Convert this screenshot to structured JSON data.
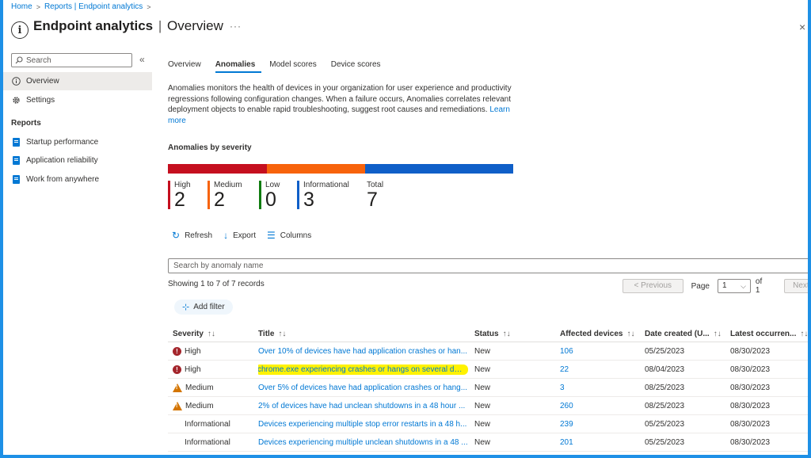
{
  "breadcrumb": {
    "home": "Home",
    "reports": "Reports | Endpoint analytics",
    "sep": ">"
  },
  "header": {
    "title_main": "Endpoint analytics",
    "title_sep": "|",
    "title_sub": "Overview",
    "more": "···",
    "close": "×"
  },
  "sidebar": {
    "search_placeholder": "Search",
    "collapse": "«",
    "items": [
      {
        "label": "Overview",
        "icon": "info-icon",
        "active": true
      },
      {
        "label": "Settings",
        "icon": "gear-icon",
        "active": false
      }
    ],
    "reports_heading": "Reports",
    "reports": [
      {
        "label": "Startup performance",
        "icon": "report-icon"
      },
      {
        "label": "Application reliability",
        "icon": "report-icon"
      },
      {
        "label": "Work from anywhere",
        "icon": "report-icon"
      }
    ]
  },
  "tabs": [
    {
      "label": "Overview",
      "active": false
    },
    {
      "label": "Anomalies",
      "active": true
    },
    {
      "label": "Model scores",
      "active": false
    },
    {
      "label": "Device scores",
      "active": false
    }
  ],
  "description": {
    "text": "Anomalies monitors the health of devices in your organization for user experience and productivity regressions following configuration changes. When a failure occurs, Anomalies correlates relevant deployment objects to enable rapid troubleshooting, suggest root causes and remediations.",
    "link": "Learn more"
  },
  "severity": {
    "heading": "Anomalies by severity",
    "colors": {
      "high": "#c50f1f",
      "medium": "#f7630c",
      "low": "#107c10",
      "informational": "#0f5fc8"
    },
    "stats": [
      {
        "label": "High",
        "value": 2
      },
      {
        "label": "Medium",
        "value": 2
      },
      {
        "label": "Low",
        "value": 0
      },
      {
        "label": "Informational",
        "value": 3
      },
      {
        "label": "Total",
        "value": 7
      }
    ]
  },
  "toolbar": {
    "refresh": "Refresh",
    "export": "Export",
    "columns": "Columns"
  },
  "search_anomaly_placeholder": "Search by anomaly name",
  "showing": "Showing 1 to 7 of 7 records",
  "pager": {
    "previous": "< Previous",
    "page_label": "Page",
    "page_value": "1",
    "of": "of 1",
    "next": "Next >"
  },
  "add_filter": "Add filter",
  "table": {
    "headers": [
      "Severity",
      "Title",
      "Status",
      "Affected devices",
      "Date created (U...",
      "Latest occurren..."
    ],
    "sort_glyph": "↑↓",
    "rows": [
      {
        "severity": "High",
        "icon": "error-icon",
        "title": "Over 10% of devices have had application crashes or han...",
        "status": "New",
        "affected": "106",
        "created": "05/25/2023",
        "latest": "08/30/2023",
        "highlight": false
      },
      {
        "severity": "High",
        "icon": "error-icon",
        "title": "chrome.exe experiencing crashes or hangs on several devi...",
        "status": "New",
        "affected": "22",
        "created": "08/04/2023",
        "latest": "08/30/2023",
        "highlight": true
      },
      {
        "severity": "Medium",
        "icon": "warning-icon",
        "title": "Over 5% of devices have had application crashes or hang...",
        "status": "New",
        "affected": "3",
        "created": "08/25/2023",
        "latest": "08/30/2023",
        "highlight": false
      },
      {
        "severity": "Medium",
        "icon": "warning-icon",
        "title": "2% of devices have had unclean shutdowns in a 48 hour ...",
        "status": "New",
        "affected": "260",
        "created": "08/25/2023",
        "latest": "08/30/2023",
        "highlight": false
      },
      {
        "severity": "Informational",
        "icon": "none",
        "title": "Devices experiencing multiple stop error restarts in a 48 h...",
        "status": "New",
        "affected": "239",
        "created": "05/25/2023",
        "latest": "08/30/2023",
        "highlight": false
      },
      {
        "severity": "Informational",
        "icon": "none",
        "title": "Devices experiencing multiple unclean shutdowns in a 48 ...",
        "status": "New",
        "affected": "201",
        "created": "05/25/2023",
        "latest": "08/30/2023",
        "highlight": false
      }
    ]
  }
}
